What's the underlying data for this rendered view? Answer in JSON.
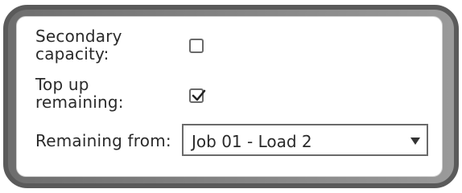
{
  "form": {
    "secondary_capacity": {
      "label_line1": "Secondary",
      "label_line2": "capacity:",
      "checked": false
    },
    "top_up_remaining": {
      "label_line1": "Top up",
      "label_line2": "remaining:",
      "checked": true
    },
    "remaining_from": {
      "label": "Remaining from:",
      "selected": "Job 01 - Load 2"
    }
  },
  "icons": {
    "checkmark": "checkmark-icon",
    "dropdown_arrow": "chevron-down-icon"
  },
  "colors": {
    "frame": "#5a5a5a",
    "text": "#2a2a2a"
  }
}
